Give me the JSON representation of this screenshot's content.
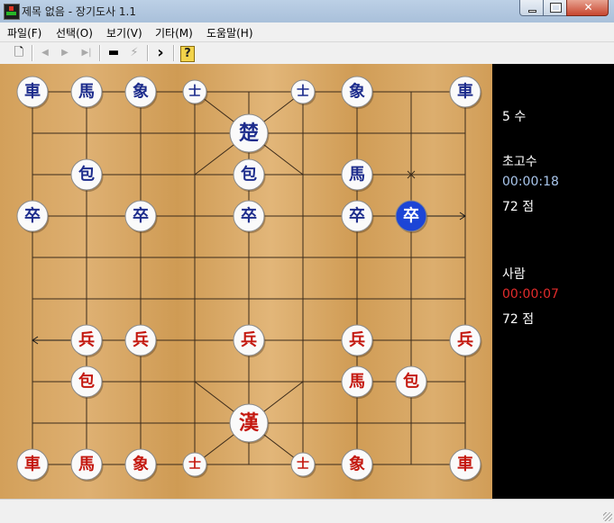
{
  "window": {
    "title": "제목 없음 - 장기도사 1.1"
  },
  "menu": [
    "파일(F)",
    "선택(O)",
    "보기(V)",
    "기타(M)",
    "도움말(H)"
  ],
  "toolbar": [
    {
      "name": "new-file-icon",
      "glyph": "🗋",
      "enabled": true
    },
    {
      "name": "move-first-icon",
      "glyph": "◀",
      "enabled": false
    },
    {
      "name": "move-back-icon",
      "glyph": "▶",
      "enabled": false
    },
    {
      "name": "move-last-icon",
      "glyph": "▶|",
      "enabled": false
    },
    {
      "name": "board-icon",
      "glyph": "▬",
      "enabled": true
    },
    {
      "name": "hint-icon",
      "glyph": "⚡",
      "enabled": false
    },
    {
      "name": "next-icon",
      "glyph": "›",
      "enabled": true
    },
    {
      "name": "help-icon",
      "glyph": "?",
      "enabled": true
    }
  ],
  "info": {
    "move_count": "5 수",
    "computer": {
      "name": "초고수",
      "time": "00:00:18",
      "score": "72 점"
    },
    "human": {
      "name": "사람",
      "time": "00:00:07",
      "score": "72 점"
    }
  },
  "colors": {
    "blue_piece": "#1d2c8c",
    "red_piece": "#c4180f",
    "selected_piece": "#1c45d6",
    "board": "#d8a865",
    "panel": "#000000",
    "computer_time": "#a9c6ec",
    "human_time": "#e22b2b"
  },
  "pieces": [
    {
      "side": "blue",
      "label": "車",
      "name": "blue-chariot",
      "col": 0,
      "row": 0
    },
    {
      "side": "blue",
      "label": "馬",
      "name": "blue-horse",
      "col": 1,
      "row": 0
    },
    {
      "side": "blue",
      "label": "象",
      "name": "blue-elephant",
      "col": 2,
      "row": 0
    },
    {
      "side": "blue",
      "label": "士",
      "name": "blue-guard",
      "col": 3,
      "row": 0
    },
    {
      "side": "blue",
      "label": "士",
      "name": "blue-guard",
      "col": 5,
      "row": 0
    },
    {
      "side": "blue",
      "label": "象",
      "name": "blue-elephant",
      "col": 6,
      "row": 0
    },
    {
      "side": "blue",
      "label": "車",
      "name": "blue-chariot",
      "col": 8,
      "row": 0
    },
    {
      "side": "blue",
      "label": "楚",
      "name": "blue-general",
      "col": 4,
      "row": 1
    },
    {
      "side": "blue",
      "label": "包",
      "name": "blue-cannon",
      "col": 1,
      "row": 2
    },
    {
      "side": "blue",
      "label": "包",
      "name": "blue-cannon",
      "col": 4,
      "row": 2
    },
    {
      "side": "blue",
      "label": "馬",
      "name": "blue-horse",
      "col": 6,
      "row": 2
    },
    {
      "side": "blue",
      "label": "卒",
      "name": "blue-soldier",
      "col": 0,
      "row": 3
    },
    {
      "side": "blue",
      "label": "卒",
      "name": "blue-soldier",
      "col": 2,
      "row": 3
    },
    {
      "side": "blue",
      "label": "卒",
      "name": "blue-soldier",
      "col": 4,
      "row": 3
    },
    {
      "side": "blue",
      "label": "卒",
      "name": "blue-soldier",
      "col": 6,
      "row": 3
    },
    {
      "side": "blue",
      "label": "卒",
      "name": "blue-soldier-selected",
      "col": 7,
      "row": 3,
      "selected": true
    },
    {
      "side": "red",
      "label": "兵",
      "name": "red-soldier",
      "col": 1,
      "row": 6
    },
    {
      "side": "red",
      "label": "兵",
      "name": "red-soldier",
      "col": 2,
      "row": 6
    },
    {
      "side": "red",
      "label": "兵",
      "name": "red-soldier",
      "col": 4,
      "row": 6
    },
    {
      "side": "red",
      "label": "兵",
      "name": "red-soldier",
      "col": 6,
      "row": 6
    },
    {
      "side": "red",
      "label": "兵",
      "name": "red-soldier",
      "col": 8,
      "row": 6
    },
    {
      "side": "red",
      "label": "包",
      "name": "red-cannon",
      "col": 1,
      "row": 7
    },
    {
      "side": "red",
      "label": "馬",
      "name": "red-horse",
      "col": 6,
      "row": 7
    },
    {
      "side": "red",
      "label": "包",
      "name": "red-cannon",
      "col": 7,
      "row": 7
    },
    {
      "side": "red",
      "label": "漢",
      "name": "red-general",
      "col": 4,
      "row": 8
    },
    {
      "side": "red",
      "label": "車",
      "name": "red-chariot",
      "col": 0,
      "row": 9
    },
    {
      "side": "red",
      "label": "馬",
      "name": "red-horse",
      "col": 1,
      "row": 9
    },
    {
      "side": "red",
      "label": "象",
      "name": "red-elephant",
      "col": 2,
      "row": 9
    },
    {
      "side": "red",
      "label": "士",
      "name": "red-guard",
      "col": 3,
      "row": 9
    },
    {
      "side": "red",
      "label": "士",
      "name": "red-guard",
      "col": 5,
      "row": 9
    },
    {
      "side": "red",
      "label": "象",
      "name": "red-elephant",
      "col": 6,
      "row": 9
    },
    {
      "side": "red",
      "label": "車",
      "name": "red-chariot",
      "col": 8,
      "row": 9
    }
  ],
  "last_move": {
    "from": {
      "col": 8,
      "row": 3
    },
    "to": {
      "col": 7,
      "row": 3
    }
  },
  "red_last_move": {
    "from": {
      "col": 0,
      "row": 6
    },
    "to": {
      "col": 1,
      "row": 6
    }
  },
  "marker": {
    "col": 7,
    "row": 2
  }
}
